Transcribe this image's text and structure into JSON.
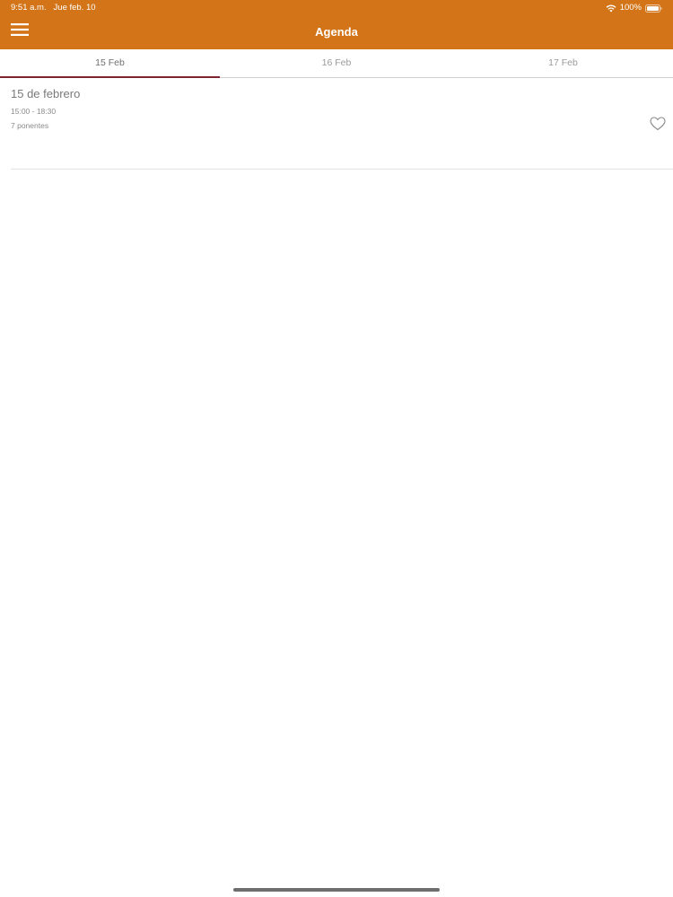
{
  "status_bar": {
    "time": "9:51 a.m.",
    "date": "Jue feb. 10",
    "battery": "100%",
    "icons": [
      "wifi-icon",
      "battery-icon"
    ]
  },
  "nav": {
    "title": "Agenda",
    "menu_icon": "hamburger-menu-icon"
  },
  "tabs": [
    {
      "label": "15 Feb",
      "selected": true
    },
    {
      "label": "16 Feb",
      "selected": false
    },
    {
      "label": "17 Feb",
      "selected": false
    }
  ],
  "sessions": [
    {
      "title": "15 de febrero",
      "time": "15:00 - 18:30",
      "speakers": "7 ponentes",
      "favorite": false,
      "favorite_icon": "heart-outline-icon"
    }
  ],
  "colors": {
    "header": "#d27417",
    "tab_indicator": "#7b2530",
    "text_secondary": "#8a8a8a"
  }
}
